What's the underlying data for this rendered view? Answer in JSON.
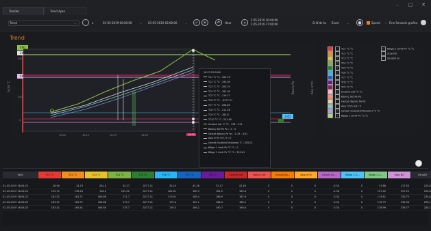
{
  "tabs": [
    "Trender",
    "Trend Ayarı"
  ],
  "window_controls": [
    "–",
    "▢",
    "✕"
  ],
  "toolbar": {
    "trend_label": "Trend",
    "start_date": "02-05-2019 06:00:00",
    "end_date": "03-05-2019 06:00:00",
    "hour_label": "Hour",
    "range_line1": "2.05.2019 16:00:00",
    "range_line2": "2.05.2019 17:00:00",
    "grid_label": "Grid'de Isı",
    "export_label": "Excel",
    "option1": "Speed",
    "option2": "Fine Sensoric grafice"
  },
  "trend_title": "Trend",
  "value_badges": [
    "400",
    "260",
    "500",
    "4.01"
  ],
  "y_ticks": [
    "400",
    "100",
    "0"
  ],
  "y_axis_label": "Sıcak °C",
  "y_axis_label2": "Basınç Pa",
  "y_axis_label3": "Akış m³/h",
  "x_ticks": [
    "16:05",
    "16:10",
    "16:15",
    "16:20",
    "16:25"
  ],
  "tooltip": {
    "time": "16:27:22.0000",
    "rows": [
      "TC1 °C °C : 202.74",
      "TC2 °C °C : 193.09",
      "TC3 °C °C : 205.70",
      "TC4 °C °C : 181.00",
      "TC5 °C °C : 219.77",
      "TC6 °C °C : -3277.21",
      "TC7 °C °C : 208.89",
      "TC8 °C °C : 211.28",
      "TC9 °C °C : 182.8",
      "TC10 °C °C : 212.60",
      "Sıcaklık Set °C °C : 195 - 215",
      "Basınç Set Pa Pa : -5 - 5",
      "Gerçek Basınç Pa Pa : -5.19 - 4.91",
      "Akış m³/h m3 / h : 0",
      "Gerçek Sıcaklık(Ortalama) °C : 205.01",
      "Bölge 1 Limit PV °C °C : 0",
      "Bölge 2 Limit PV °C °C : 325.61"
    ]
  },
  "legend": [
    {
      "label": "TC1 °C °C",
      "color": "#e53935",
      "checked": false
    },
    {
      "label": "TC2 °C °C",
      "color": "#ef8e1e",
      "checked": false
    },
    {
      "label": "TC3 °C °C",
      "color": "#e8c22a",
      "checked": true
    },
    {
      "label": "TC4 °C °C",
      "color": "#7cb342",
      "checked": true
    },
    {
      "label": "TC5 °C °C",
      "color": "#2e7d32",
      "checked": true
    },
    {
      "label": "TC6 °C °C",
      "color": "#29b6f6",
      "checked": true
    },
    {
      "label": "TC7 °C °C",
      "color": "#1565c0",
      "checked": false
    },
    {
      "label": "TC8 °C °C",
      "color": "#6a1b9a",
      "checked": false
    },
    {
      "label": "TC9 °C °C",
      "color": "#ad1457",
      "checked": false
    },
    {
      "label": "Sıcaklık Set °C °C",
      "color": "#f8bbd0",
      "checked": true
    },
    {
      "label": "Basınç Set Pa Pa",
      "color": "#ff8a80",
      "checked": false
    },
    {
      "label": "Gerçek Basınç Pa Pa",
      "color": "#ffcc80",
      "checked": false
    },
    {
      "label": "Akış m³/h m3 / h",
      "color": "#80cbc4",
      "checked": false
    },
    {
      "label": "Gerçek Sıcaklık(Ortalama) °C °C",
      "color": "#b39ddb",
      "checked": true
    },
    {
      "label": "Bölge 1 Limit PV °C °C",
      "color": "#aed581",
      "checked": true
    }
  ],
  "legend_right": [
    {
      "label": "Bölge 2 Limit PV °C °C",
      "checked": true
    },
    {
      "label": "Stop Nü",
      "checked": false
    },
    {
      "label": "Sensörl on",
      "checked": false
    }
  ],
  "grid": {
    "headers": [
      {
        "label": "Tarih",
        "color": "#2a2b30"
      },
      {
        "label": "TC1 °C",
        "color": "#e53935"
      },
      {
        "label": "TC2 °C",
        "color": "#ef8e1e"
      },
      {
        "label": "TC3 °C",
        "color": "#e8c22a"
      },
      {
        "label": "TC4 °C",
        "color": "#7cb342"
      },
      {
        "label": "TC5 °C",
        "color": "#2e7d32"
      },
      {
        "label": "TC6 °C",
        "color": "#29b6f6"
      },
      {
        "label": "TC7 °C",
        "color": "#1565c0"
      },
      {
        "label": "TC8 °C",
        "color": "#6a1b9a"
      },
      {
        "label": "Sıcaklık Set",
        "color": "#c62828"
      },
      {
        "label": "Basınç Set",
        "color": "#ef5350"
      },
      {
        "label": "Gerçek Ba...",
        "color": "#f57c00"
      },
      {
        "label": "Akış m³/h",
        "color": "#ffa726"
      },
      {
        "label": "Gerçek Sıc...",
        "color": "#ba68c8"
      },
      {
        "label": "Bölge 1 Li...",
        "color": "#4fc3f7"
      },
      {
        "label": "Bölge 2 Li...",
        "color": "#81c784"
      },
      {
        "label": "Stop Nü",
        "color": "#ce93d8"
      },
      {
        "label": "Sensörl",
        "color": "#2a2b30"
      }
    ],
    "rows": [
      [
        "02-05-2019 16:04:22",
        "28.90",
        "24.70",
        "28.10",
        "32.27",
        "-3277.21",
        "32.10",
        "41.26",
        "33.17",
        "42.40",
        "0",
        "0",
        "0",
        "-0.34",
        "0",
        "37.86",
        "217.53",
        "223.04"
      ],
      [
        "02-05-2019 16:04:22",
        "132.11",
        "136.24",
        "136.2",
        "152.02",
        "-3277.21",
        "162.81",
        "180.3",
        "181.5",
        "183.6",
        "0",
        "0",
        "0",
        "-2.38",
        "0",
        "157.49",
        "227.25",
        "230.61"
      ],
      [
        "02-05-2019 16:04:22",
        "161.51",
        "161.71",
        "163.89",
        "171.7",
        "-3277.21",
        "173.91",
        "185.4",
        "186.9",
        "187.9",
        "0",
        "0",
        "0",
        "-0.34",
        "0",
        "174.61",
        "230.75",
        "234.66"
      ],
      [
        "02-05-2019 16:04:22",
        "163.21",
        "163.71",
        "165.88",
        "173.7",
        "-3277.21",
        "175.4",
        "187.1",
        "188.4",
        "189.2",
        "0",
        "0",
        "0",
        "-0.34",
        "0",
        "176.73",
        "234.96",
        "239.17"
      ],
      [
        "02-05-2019 16:04:22",
        "163.41",
        "165.41",
        "165.89",
        "175.7",
        "-3277.21",
        "176.3",
        "189.2",
        "190.7",
        "190.6",
        "0",
        "0",
        "0",
        "-0.34",
        "0",
        "178.99",
        "239.77",
        "245.18"
      ]
    ]
  }
}
